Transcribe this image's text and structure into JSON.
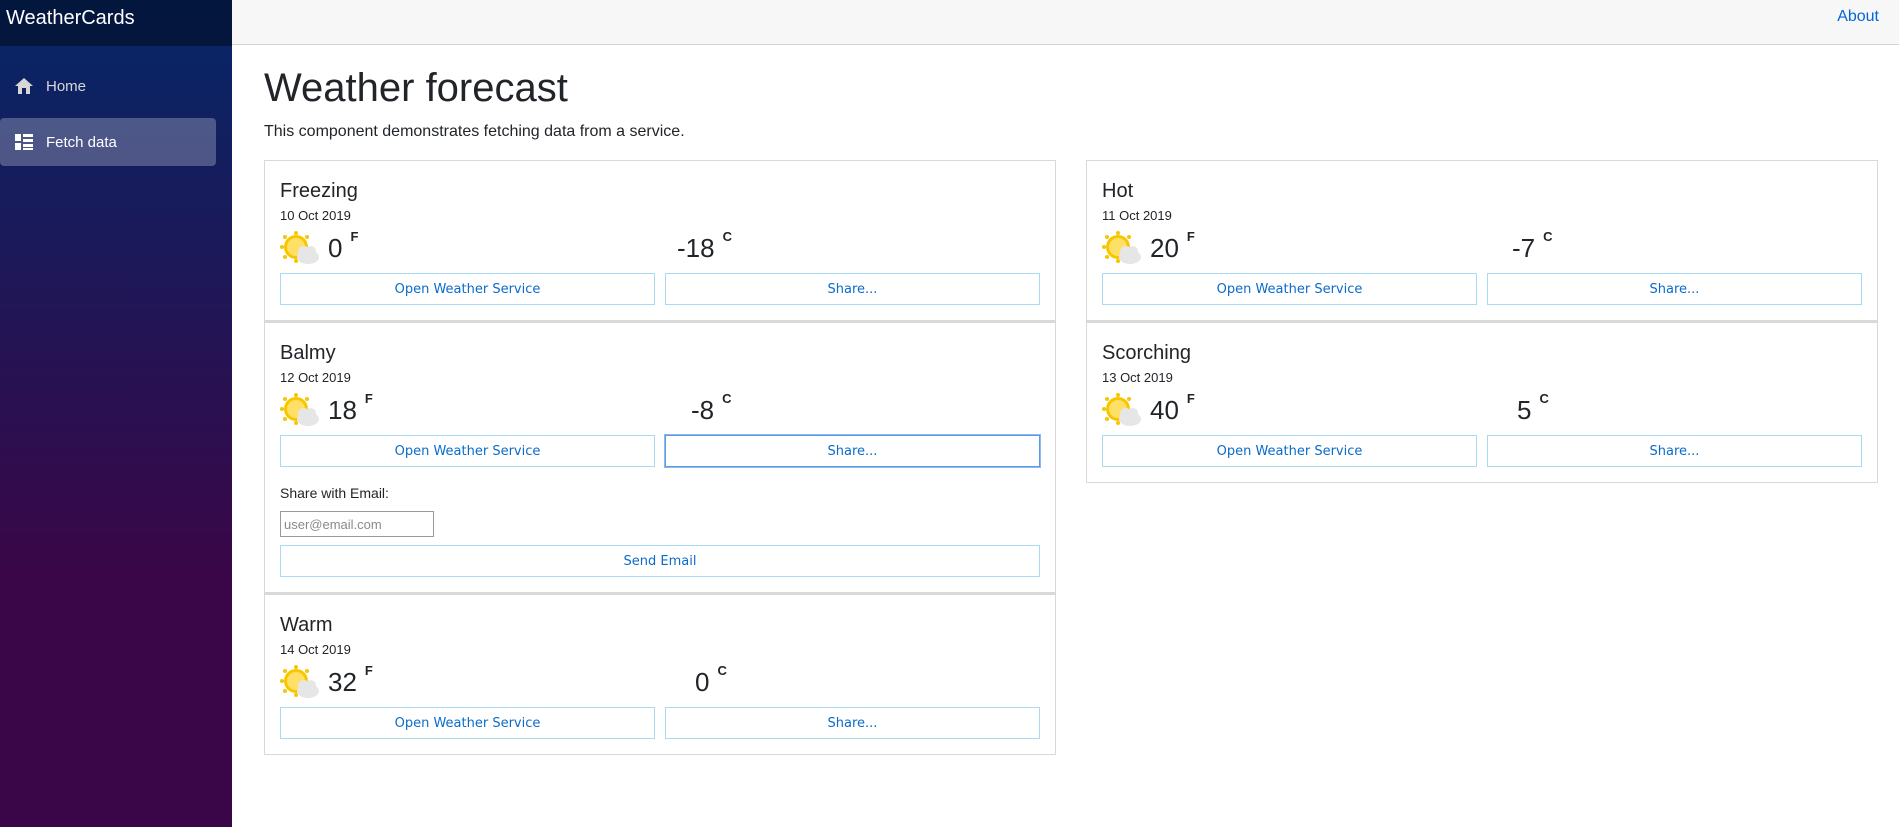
{
  "app": {
    "brand": "WeatherCards"
  },
  "nav": {
    "items": [
      {
        "label": "Home",
        "icon": "home-icon",
        "active": false
      },
      {
        "label": "Fetch data",
        "icon": "list-icon",
        "active": true
      }
    ]
  },
  "topbar": {
    "about_label": "About"
  },
  "page": {
    "title": "Weather forecast",
    "description": "This component demonstrates fetching data from a service."
  },
  "colors": {
    "accent": "#0b6bcb",
    "sidebar_top": "#052767",
    "sidebar_bottom": "#3a0647",
    "sun": "#f7c600"
  },
  "cards": {
    "freezing": {
      "summary": "Freezing",
      "date": "10 Oct 2019",
      "temp_f": "0",
      "temp_c": "-18",
      "unit_f": "F",
      "unit_c": "C",
      "open_label": "Open Weather Service",
      "share_label": "Share..."
    },
    "hot": {
      "summary": "Hot",
      "date": "11 Oct 2019",
      "temp_f": "20",
      "temp_c": "-7",
      "unit_f": "F",
      "unit_c": "C",
      "open_label": "Open Weather Service",
      "share_label": "Share..."
    },
    "balmy": {
      "summary": "Balmy",
      "date": "12 Oct 2019",
      "temp_f": "18",
      "temp_c": "-8",
      "unit_f": "F",
      "unit_c": "C",
      "open_label": "Open Weather Service",
      "share_label": "Share...",
      "share_panel": {
        "label": "Share with Email:",
        "placeholder": "user@email.com",
        "send_label": "Send Email"
      }
    },
    "scorching": {
      "summary": "Scorching",
      "date": "13 Oct 2019",
      "temp_f": "40",
      "temp_c": "5",
      "unit_f": "F",
      "unit_c": "C",
      "open_label": "Open Weather Service",
      "share_label": "Share..."
    },
    "warm": {
      "summary": "Warm",
      "date": "14 Oct 2019",
      "temp_f": "32",
      "temp_c": "0",
      "unit_f": "F",
      "unit_c": "C",
      "open_label": "Open Weather Service",
      "share_label": "Share..."
    }
  }
}
